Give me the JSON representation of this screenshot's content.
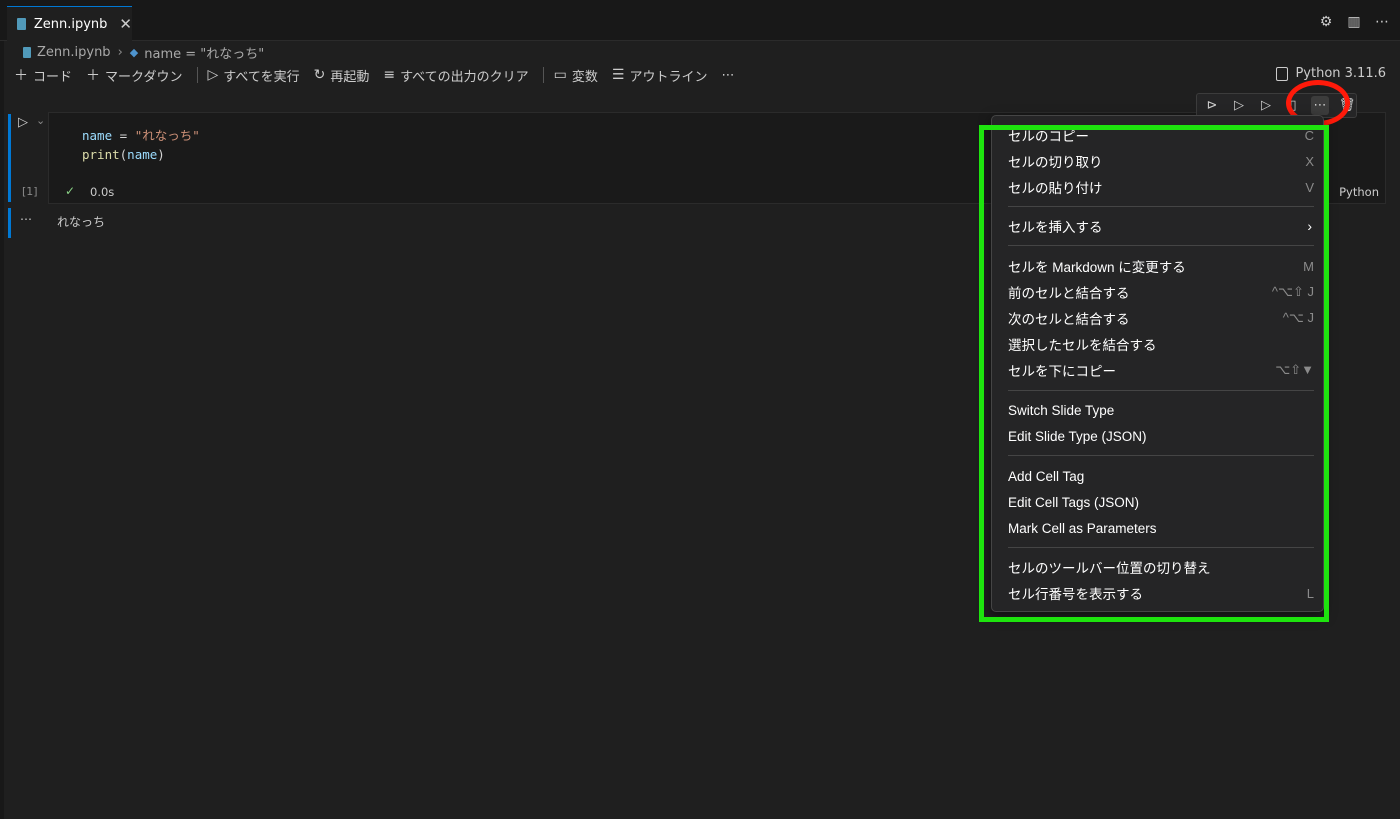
{
  "tab": {
    "label": "Zenn.ipynb",
    "close": "✕"
  },
  "tab_actions": {
    "settings": "⚙",
    "split": "▥",
    "more": "⋯"
  },
  "breadcrumb": {
    "file": "Zenn.ipynb",
    "symbol": "name = \"れなっち\""
  },
  "toolbar": {
    "code": "コード",
    "markdown": "マークダウン",
    "run_all": "すべてを実行",
    "restart": "再起動",
    "clear_outputs": "すべての出力のクリア",
    "variables": "変数",
    "outline": "アウトライン",
    "more": "⋯"
  },
  "kernel": {
    "label": "Python 3.11.6"
  },
  "cell": {
    "execution_count": "[1]",
    "exec_time": "0.0s",
    "language": "Python",
    "line1": {
      "var": "name",
      "op": " = ",
      "str": "\"れなっち\""
    },
    "line2": {
      "fn": "print",
      "open": "(",
      "arg": "name",
      "close": ")"
    }
  },
  "output": {
    "more": "⋯",
    "text": "れなっち"
  },
  "menu": {
    "items": [
      {
        "label": "セルのコピー",
        "kb": "C"
      },
      {
        "label": "セルの切り取り",
        "kb": "X"
      },
      {
        "label": "セルの貼り付け",
        "kb": "V"
      },
      {
        "label": "セルを挿入する",
        "kb": ""
      },
      {
        "label": "セルを Markdown に変更する",
        "kb": "M"
      },
      {
        "label": "前のセルと結合する",
        "kb": "^⌥⇧ J"
      },
      {
        "label": "次のセルと結合する",
        "kb": "^⌥ J"
      },
      {
        "label": "選択したセルを結合する",
        "kb": ""
      },
      {
        "label": "セルを下にコピー",
        "kb": "⌥⇧▼"
      },
      {
        "label": "Switch Slide Type",
        "kb": ""
      },
      {
        "label": "Edit Slide Type (JSON)",
        "kb": ""
      },
      {
        "label": "Add Cell Tag",
        "kb": ""
      },
      {
        "label": "Edit Cell Tags (JSON)",
        "kb": ""
      },
      {
        "label": "Mark Cell as Parameters",
        "kb": ""
      },
      {
        "label": "セルのツールバー位置の切り替え",
        "kb": ""
      },
      {
        "label": "セル行番号を表示する",
        "kb": "L"
      }
    ],
    "submenu_arrow": "›"
  },
  "colors": {
    "accent": "#0078d4",
    "annotation_red": "#ff1a0a",
    "annotation_green": "#1ee40e"
  }
}
